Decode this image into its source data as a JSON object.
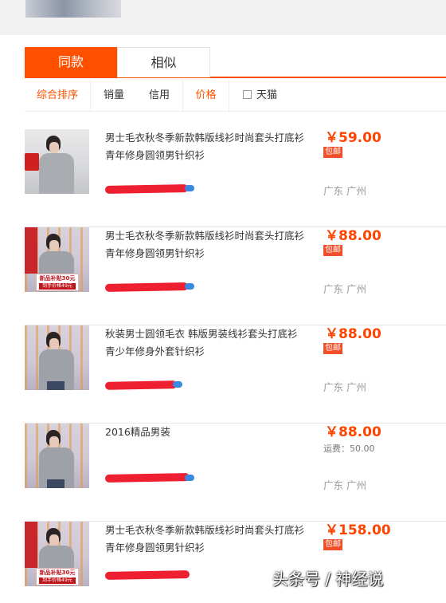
{
  "tabs": [
    {
      "label": "同款",
      "active": true
    },
    {
      "label": "相似",
      "active": false
    }
  ],
  "sort": {
    "overall": "综合排序",
    "sales": "销量",
    "credit": "信用",
    "price": "价格",
    "tmall": "天猫"
  },
  "items": [
    {
      "title": "男士毛衣秋冬季新款韩版线衫时尚套头打底衫青年修身圆领男针织衫",
      "price": "￥59.00",
      "badge": "包邮",
      "location": "广东 广州",
      "thumb_style": "street-red-car"
    },
    {
      "title": "男士毛衣秋冬季新款韩版线衫时尚套头打底衫青年修身圆领男针织衫",
      "price": "￥88.00",
      "badge": "包邮",
      "location": "广东 广州",
      "thumb_style": "promo",
      "promo_top": "新品补贴30元",
      "promo_bottom": "到手价格49元"
    },
    {
      "title": "秋装男士圆领毛衣 韩版男装线衫套头打底衫青少年修身外套针织衫",
      "price": "￥88.00",
      "badge": "包邮",
      "location": "广东 广州",
      "thumb_style": "studio"
    },
    {
      "title": "2016精品男装",
      "price": "￥88.00",
      "shipping": "运费：50.00",
      "location": "广东 广州",
      "thumb_style": "studio"
    },
    {
      "title": "男士毛衣秋冬季新款韩版线衫时尚套头打底衫青年修身圆领男针织衫",
      "price": "￥158.00",
      "badge": "包邮",
      "location": "",
      "thumb_style": "promo",
      "promo_top": "新品补贴30元",
      "promo_bottom": "到手价格49元"
    }
  ],
  "watermark": "头条号 / 神经说",
  "colors": {
    "accent": "#ff5000",
    "price": "#ff4400",
    "badge": "#f04f2a"
  }
}
